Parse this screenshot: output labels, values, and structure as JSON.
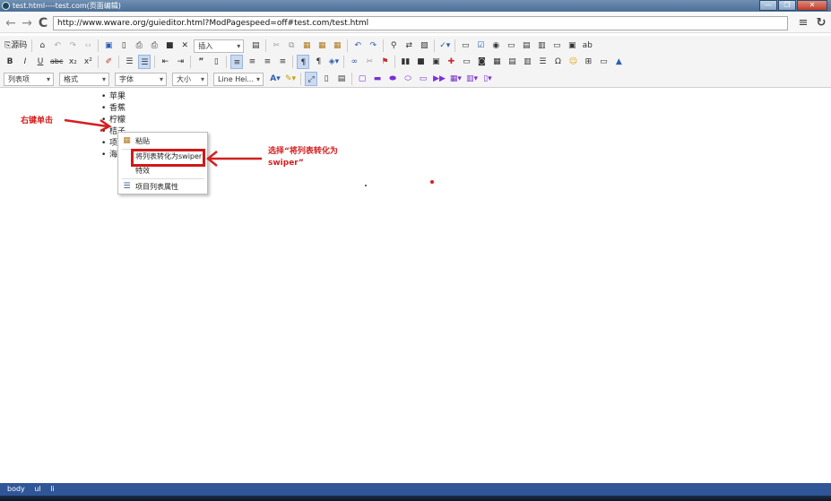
{
  "window": {
    "title": "test.html----test.com(页面编辑)",
    "controls": {
      "minimize": "—",
      "maximize": "❐",
      "close": "✕"
    }
  },
  "nav": {
    "back_icon": "←",
    "forward_icon": "→",
    "reload_icon": "C",
    "url": "http://www.wware.org/guieditor.html?ModPagespeed=off#test.com/test.html",
    "menu_icon": "≡",
    "refresh_icon": "↻"
  },
  "toolbar": {
    "source_label": "源码",
    "insert_dropdown": "插入",
    "list_item_dropdown": "列表项",
    "format_dropdown": "格式",
    "font_dropdown": "字体",
    "size_dropdown": "大小",
    "line_height_dropdown": "Line Hei...",
    "bold": "B",
    "italic": "I",
    "underline": "U",
    "strike": "abc",
    "subscript": "x₂",
    "superscript": "x²",
    "omega": "Ω",
    "smiley": "☺"
  },
  "editor": {
    "list_items": [
      "苹果",
      "香蕉",
      "柠檬",
      "桔子",
      "项",
      "海"
    ]
  },
  "context_menu": {
    "paste": "粘贴",
    "convert_to_swiper": "将列表转化为swiper",
    "effects": "特效",
    "list_properties": "项目列表属性"
  },
  "annotations": {
    "right_click": "右键单击",
    "select_line1": "选择“将列表转化为",
    "select_line2": "swiper”"
  },
  "statusbar": {
    "path": [
      "body",
      "ul",
      "li"
    ]
  },
  "colors": {
    "annotation_red": "#d41f1f",
    "status_blue": "#2f5697"
  }
}
